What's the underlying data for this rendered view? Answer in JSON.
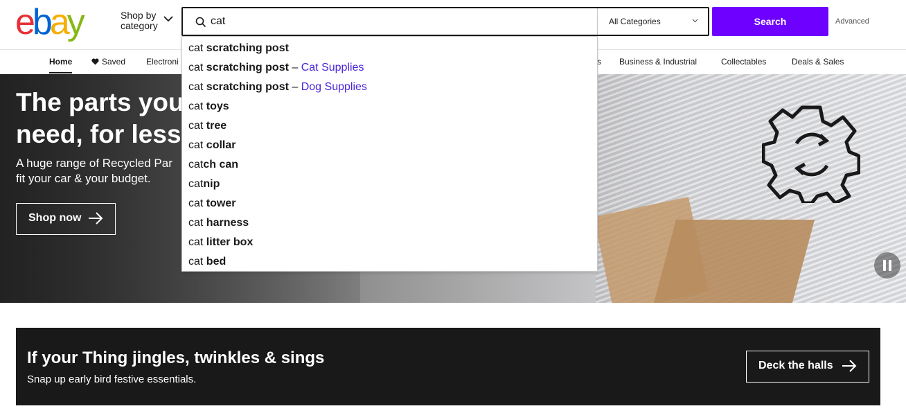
{
  "header": {
    "logo_letters": [
      {
        "char": "e",
        "color": "#e53238"
      },
      {
        "char": "b",
        "color": "#0064d2"
      },
      {
        "char": "a",
        "color": "#f5af02"
      },
      {
        "char": "y",
        "color": "#86b817"
      }
    ],
    "shop_by_line1": "Shop by",
    "shop_by_line2": "category",
    "search_value": "cat",
    "category_select": "All Categories",
    "search_button": "Search",
    "advanced_link": "Advanced"
  },
  "nav": {
    "items": [
      {
        "label": "Home"
      },
      {
        "label": "Saved"
      },
      {
        "label": "Electroni"
      },
      {
        "label": "s"
      },
      {
        "label": "Business & Industrial"
      },
      {
        "label": "Collectables"
      },
      {
        "label": "Deals & Sales"
      }
    ]
  },
  "suggestions": [
    {
      "prefix": "cat",
      "bold": " scratching post",
      "sep": "",
      "category": ""
    },
    {
      "prefix": "cat",
      "bold": " scratching post",
      "sep": " – ",
      "category": "Cat Supplies"
    },
    {
      "prefix": "cat",
      "bold": " scratching post",
      "sep": " – ",
      "category": "Dog Supplies"
    },
    {
      "prefix": "cat",
      "bold": " toys",
      "sep": "",
      "category": ""
    },
    {
      "prefix": "cat",
      "bold": " tree",
      "sep": "",
      "category": ""
    },
    {
      "prefix": "cat",
      "bold": " collar",
      "sep": "",
      "category": ""
    },
    {
      "prefix": "cat",
      "bold": "ch can",
      "sep": "",
      "category": ""
    },
    {
      "prefix": "cat",
      "bold": "nip",
      "sep": "",
      "category": ""
    },
    {
      "prefix": "cat",
      "bold": " tower",
      "sep": "",
      "category": ""
    },
    {
      "prefix": "cat",
      "bold": " harness",
      "sep": "",
      "category": ""
    },
    {
      "prefix": "cat",
      "bold": " litter box",
      "sep": "",
      "category": ""
    },
    {
      "prefix": "cat",
      "bold": " bed",
      "sep": "",
      "category": ""
    }
  ],
  "hero": {
    "title_line1": "The parts you",
    "title_line2": "need, for less",
    "subtitle_line1": "A huge range of Recycled Par",
    "subtitle_line2": "fit your car & your budget.",
    "cta": "Shop now"
  },
  "banner": {
    "title": "If your Thing jingles, twinkles & sings",
    "subtitle": "Snap up early bird festive essentials.",
    "cta": "Deck the halls"
  },
  "colors": {
    "accent": "#6e00ff",
    "suggestion_category": "#4a24d8",
    "banner_bg": "#191919"
  }
}
